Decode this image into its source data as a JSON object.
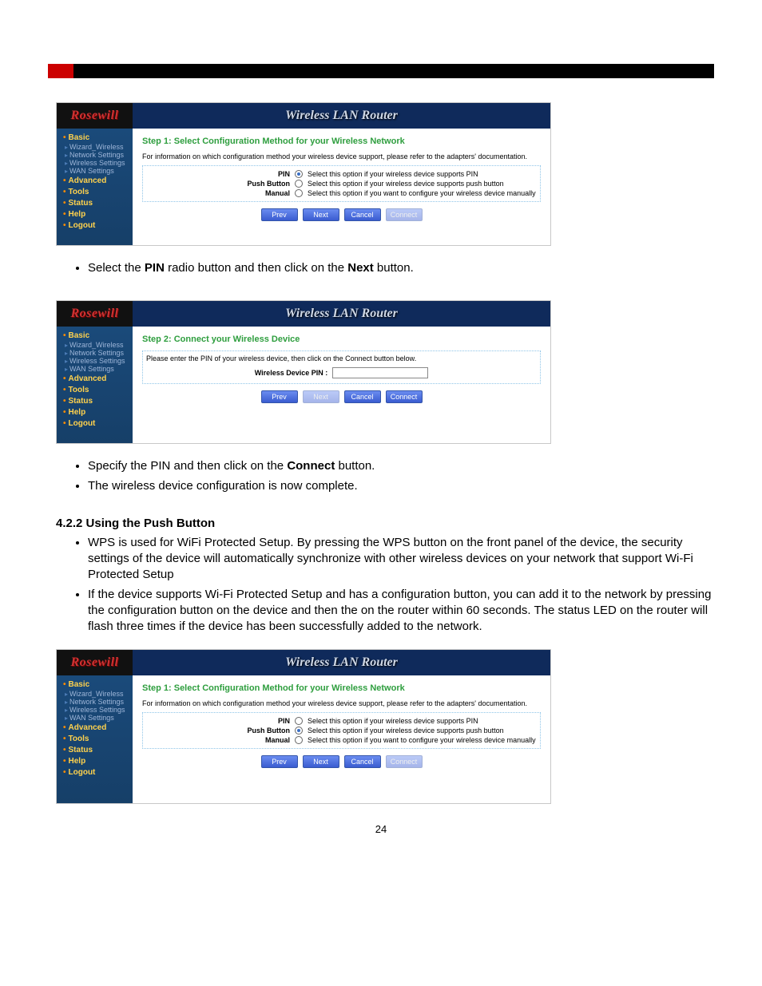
{
  "brand": "Rosewill",
  "router_title": "Wireless LAN Router",
  "nav": {
    "major": [
      "Basic",
      "Advanced",
      "Tools",
      "Status",
      "Help",
      "Logout"
    ],
    "sub": [
      "Wizard_Wireless",
      "Network Settings",
      "Wireless Settings",
      "WAN Settings"
    ]
  },
  "panel1": {
    "step": "Step 1: Select Configuration Method for your Wireless Network",
    "info": "For information on which configuration method your wireless device support, please refer to the adapters' documentation.",
    "options": [
      {
        "label": "PIN",
        "checked": true,
        "desc": "Select this option if your wireless device supports PIN"
      },
      {
        "label": "Push Button",
        "checked": false,
        "desc": "Select this option if your wireless device supports push button"
      },
      {
        "label": "Manual",
        "checked": false,
        "desc": "Select this option if you want to configure your wireless device manually"
      }
    ],
    "buttons": {
      "prev": "Prev",
      "next": "Next",
      "cancel": "Cancel",
      "connect": "Connect"
    }
  },
  "panel2": {
    "step": "Step 2: Connect your Wireless Device",
    "info": "Please enter the PIN of your wireless device, then click on the Connect button below.",
    "pin_label": "Wireless Device PIN :",
    "buttons": {
      "prev": "Prev",
      "next": "Next",
      "cancel": "Cancel",
      "connect": "Connect"
    }
  },
  "panel3": {
    "step": "Step 1: Select Configuration Method for your Wireless Network",
    "info": "For information on which configuration method your wireless device support, please refer to the adapters' documentation.",
    "options": [
      {
        "label": "PIN",
        "checked": false,
        "desc": "Select this option if your wireless device supports PIN"
      },
      {
        "label": "Push Button",
        "checked": true,
        "desc": "Select this option if your wireless device supports push button"
      },
      {
        "label": "Manual",
        "checked": false,
        "desc": "Select this option if you want to configure your wireless device manually"
      }
    ],
    "buttons": {
      "prev": "Prev",
      "next": "Next",
      "cancel": "Cancel",
      "connect": "Connect"
    }
  },
  "doc": {
    "bullet1_a": "Select the ",
    "bullet1_b": "PIN",
    "bullet1_c": " radio button and then click on the ",
    "bullet1_d": "Next",
    "bullet1_e": " button.",
    "bullet2_a": "Specify the PIN and then click on the ",
    "bullet2_b": "Connect",
    "bullet2_c": " button.",
    "bullet3": "The wireless device configuration is now complete.",
    "section": "4.2.2  Using the Push Button",
    "bullet4": "WPS is used for WiFi Protected Setup. By pressing the WPS button on the front panel of the device, the security settings of the device will automatically synchronize with other wireless devices on your network that support Wi-Fi Protected Setup",
    "bullet5": "If the device supports Wi-Fi Protected Setup and has a configuration button, you can add it to the network by pressing the configuration button on the device and then the on the router within 60 seconds. The status LED on the router will flash three times if the device has been successfully added to the network.",
    "page_number": "24"
  }
}
